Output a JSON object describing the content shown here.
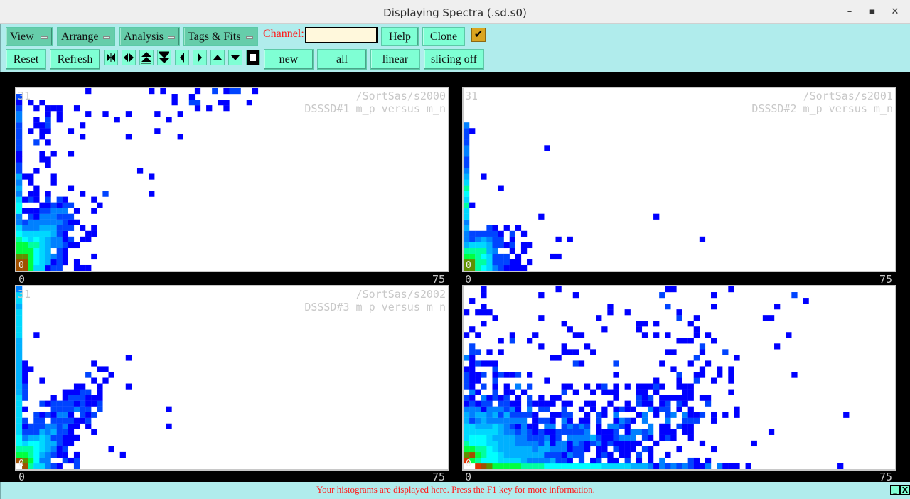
{
  "window": {
    "title": "Displaying Spectra (.sd.s0)",
    "minimize_icon": "minimize-icon",
    "maximize_icon": "maximize-icon",
    "close_icon": "close-icon"
  },
  "menus": [
    {
      "label": "View"
    },
    {
      "label": "Arrange"
    },
    {
      "label": "Analysis"
    },
    {
      "label": "Tags & Fits"
    }
  ],
  "channel": {
    "label": "Channel:",
    "value": ""
  },
  "buttons": {
    "help": "Help",
    "clone": "Clone",
    "reset": "Reset",
    "refresh": "Refresh",
    "new": "new",
    "all": "all",
    "linear": "linear",
    "slicing": "slicing off"
  },
  "checkbox": {
    "checked": true,
    "color": "#daa520"
  },
  "nav_icons": [
    "shrink-horizontal-icon",
    "expand-horizontal-icon",
    "double-up-icon",
    "double-down-icon",
    "left-icon",
    "right-icon",
    "up-icon",
    "down-icon",
    "stop-icon"
  ],
  "palette": [
    "",
    "#0000ff",
    "#0044ff",
    "#0080ff",
    "#00b0ff",
    "#00d8ff",
    "#00ffff",
    "#00ffa0",
    "#00ff40",
    "#609000",
    "#a05000",
    "#e03000"
  ],
  "panels": [
    {
      "name": "/SortSas/s2000",
      "title": "DSSSD#1 m_p versus m_n",
      "ymax": "31",
      "ymin": "0",
      "xmin": "0",
      "xmax": "75",
      "rows": {
        "31": "12 23 25 31 34:2 36 37-38:2 41",
        "30": "0:2 27 30",
        "29": "0 2 4 27 30-31:2 35 36 40",
        "28": "0:2 3 5-7 10 31 33 36",
        "27": "0:3 5 7 12 15 19 24 28",
        "26": "0:3 3 5:2 7 17 26",
        "25": "0:2 3 4 5:2 11",
        "24": "0:2 2 4 5 9 24",
        "23": "0:2 4 11 19 28",
        "22": "0:2 3:2 5",
        "21": "0:2",
        "20": "0 4 6 9",
        "19": "0 4 5",
        "18": "0:2 5",
        "17": "0:2 3 21",
        "16": "0:4 1 2 6 23",
        "15": "0:3 2 6",
        "14": "0:4 3 9",
        "13": "0:3 2 3 5 11 15:2 23",
        "12": "0:5 1 2:2 3 5:2 7:2 8 13",
        "11": "0:6 4 5 6:2 7 8-9:2 14",
        "10": "0:6 1-3 4-5:2 6-8:3 10 13",
        "9": "0:3 2:2 3 4-6:3 7-9:2",
        "8": "0:3 1:2 2-7:3 8:2 9-10",
        "7": "0:5 1-3:3 4-6:4 7-9:2 11 13",
        "6": "0:6 1-5:5 6:4 7:2 8 12 13",
        "5": "0:7 1:6 2:5 3:6 4:5 5:4 6-7:3 8 9:2 11 12",
        "4": "0-1:8 2-3:7 4:5 5:4 6-7:3 8:2 9-10",
        "3": "0-2:8 3:6 4:5 5:4 7:2 8",
        "2": "0-1:9 2:8 3:6 4:5 5:4 6:3 7:2 8 13",
        "1": "0-1:a 2:8 3:6 4:5 5:4 6 7:2 8 10",
        "0": "0-1:a 2:8 3-4:5 5 6-7:2 10-12"
      }
    },
    {
      "name": "/SortSas/s2001",
      "title": "DSSSD#2 m_p versus m_n",
      "ymax": "31",
      "ymin": "0",
      "xmin": "0",
      "xmax": "75",
      "rows": {
        "25": "0:3",
        "24": "0:2 1",
        "23": "0:2",
        "22": "0:2",
        "21": "0:3 14",
        "20": "0:3",
        "19": "0:2",
        "18": "0:2",
        "17": "0:3",
        "16": "0:4 3",
        "15": "0:5",
        "14": "0:7 6",
        "13": "0:6",
        "12": "0:5",
        "11": "0:7 1",
        "10": "0:5",
        "9": "0:5 13 33",
        "8": "0:3",
        "7": "0:4 4:2 5 7 9",
        "6": "0:3 1-5:2 6 8:2 10",
        "5": "0:3 1:2 2:3 3:4 4:3 5-6:2 8 16 18 41",
        "4": "0:4 1-3:5 4:4 5-6:2 7 8:2 10-11",
        "3": "0-3:7 4:4 5:3 8 10",
        "2": "0-1:8 2:7 3:6 4:5 5-7:2 9 15-16",
        "1": "0-1:9 2-3:7 4:5 5-7:2 8-9 11",
        "0": "0-1:9 2:7 3:6 4:5 5:3 6:2 7-10"
      }
    },
    {
      "name": "/SortSas/s2002",
      "title": "DSSSD#3 m_p versus m_n",
      "ymax": "31",
      "ymin": "0",
      "xmin": "0",
      "xmax": "75",
      "rows": {
        "31": "0:3",
        "30": "0:5",
        "29": "0:5",
        "28": "0:4",
        "27": "0:5",
        "26": "0:5",
        "25": "0:5",
        "24": "0:5",
        "23": "0:5 3",
        "22": "0:4",
        "21": "0:4",
        "20": "0:4",
        "19": "0:4 19",
        "18": "0:4 1 13",
        "17": "0:4 1-2 14-15",
        "16": "0:4 1 12:2 16",
        "15": "0:4 1 4 13 15",
        "14": "0:4 1:2 10-11 14 19",
        "13": "0:4 1:2 8-10 11-12:2 14",
        "12": "0:5 1:2 6 8 9-11:2 12-14",
        "11": "0:5 4:2 5 6-9:2 10 11:2 12-13 14:2",
        "10": "0:5 1 6-9:2 10:3 11-12:2 14:2 26",
        "9": "0:5 3:2 4 5:2 6 7-8:3 9 11:2 12 13:2",
        "8": "0:5 1:2 3-4:2 6-9:2 10-11 12:2",
        "7": "0:5 1 2-4:2 5-6:3 7:2 8:3 9-10 12 26",
        "6": "0:5 1-3:2 4:4 5:3 6:4 7-8:2 9 13",
        "5": "0:6 1:3 2-3:4 4:5 5:4 6-7:2 8-10",
        "4": "0:6 1:5 2-3:6 4:5 5-6:4 7:2 8-9",
        "3": "0-2:7 3:6 4:5 5:4 6:3 7 8:2 16",
        "2": "0-1:8 2:7 3:6 4:4 5:3 6:2 7-8 10 18",
        "1": "0:a 1:9 2:8 3:6 4-5:3 8:2 9 10:2",
        "0": "1:a 2:7 3-4:5 5:3 6:2 7 10:2"
      }
    },
    {
      "name": "",
      "title": "",
      "ymax": "",
      "ymin": "0",
      "xmin": "0",
      "xmax": "75",
      "rows": {
        "31": "3 16 35-36 46",
        "30": "3 13 19 34:2 43 57:2",
        "29": "1 59",
        "28": "3 25 35:2 43 54",
        "27": "0 2-4 25 28 37",
        "26": "5 13 23 37:2 40 52-53",
        "25": "3 17 30-31 33 39",
        "24": "1 18 24 30 40",
        "23": "0 2 8 12 19-20 31 33 35 40 42 56",
        "22": "6 8:2 11 37 38 39 43",
        "21": "1:2 13 17 21 41:2 54",
        "20": "1-2:2 4 6 17-19 22 35-36 41 45:2",
        "19": "0:3 1 15-16 40:2 47",
        "18": "1 2:2 3-5 19:2 20 26:2 34 39 42",
        "17": "0-1 5:2 36 41 44 46",
        "16": "0:2 1-2 3:2 5 6:2 7-8 9:2 11 26 37:2 40-41 44 46 57",
        "15": "0:2 1-2 5:2 14 33 37 40:2 43 46",
        "14": "0:2 1 3:2 5 7 9:3 11:2 17-18 21 23 24:2 26 28 30-32 33:2 34 37-39",
        "13": "1:3 2 5:2 7-8 10 17:2 19 22 24-26 30-31 33 38-39 46",
        "12": "0:2 1 3:3 4 5:2 6 7:2 9 11:2 13 15-16 26 30:2 31 32:2 34-39 41-42",
        "11": "0 1:2 2 3-4:2 6-7:2 8-9 11:2 12-15 17-18 21-22 25 28 30:2 31-32 34 35:2 37:2 38 42:2",
        "10": "0-2:3 3 4-6:3 7:2 8:3 9 11:3 13-14:2 17:2 20 22 24 26 27:2 28-29 32:3 33 34-35:2 37 39 47",
        "9": "0:4 1:3 2-3:4 4:3 5:4 6:2 7:4 8-11:2 12 15-16 17-18:2 21 23:2 24 26:3 30 31:3 33 35:2 36:3 38:3 39-40 41:2 43 45 47 66",
        "8": "0:4 1:2 2:3 3:4 4-10:3 12 13-14:2 15 17:3 18 20-21 23:2 26 27:3 28:2 29 31:3 35:3 38-40:2 43",
        "7": "0-1:5 2-4:4 5:5 6:4 7:3 8:2 9 10:3 11-12 14-15:3 17:2 18:3 19:2 20:3 21:2 23 25-26:3 27:2 28 32:3 34-35 37:2 38-39",
        "6": "0-5:5 6:4 7-8:3 9:2 10:3 11:2 12 13:2 14-15 16-20:2 21:3 23-25 26:2 28 29-30:3 31:2 32:3 34-36 38-39 53",
        "5": "0:5 1-3:6 4:5 5-8:4 9-10:3 11-13:2 14:3 15 16:2 18-21:3 22:4 23:2 24-25 26:2 27-29:3 31:2 32 34 35:2 36 39",
        "4": "0:7 1-3:6 4-5:5 6-8:4 9-12:3 13:2 14:4 15 16-17:3 18 19:3 20:2 21 22:2 23:3 24 25:2 26-30 33 41 50",
        "3": "0-1:8 2-3:7 4:6 5:5 6-11:4 12:3 13-14:4 15-17:3 18 19-20:2 21 23 24 26:2 27-29 31:2 32 37 43",
        "2": "0:9 1:a 2:8 3:7 4-5:6 6:5 7-13:4 14-16:2 17 18:3 19-20:2 23 24:2 25 27-28 30:2 32 35",
        "1": "0:b 1:8 2:7 3-5:6 6-9:5 10:4 11-14:3 15:4 16-17:2 18 20:2 22 23:2 25-26 28:2 30 32 34:3 39:2 40 42",
        "0": "2:b 3:a 4:9 5-9:8 10-13:7 14-17:6 18-23:6 24-28:5 29-31:4 32:3 33 34:3 35:2 36:3 37:2 38:3 39:2 40-41 42:3 44:3 45-47 49 65"
      }
    }
  ],
  "status": {
    "message": "Your histograms are displayed here. Press the F1 key for more information.",
    "minimize": "_",
    "close": "X"
  }
}
